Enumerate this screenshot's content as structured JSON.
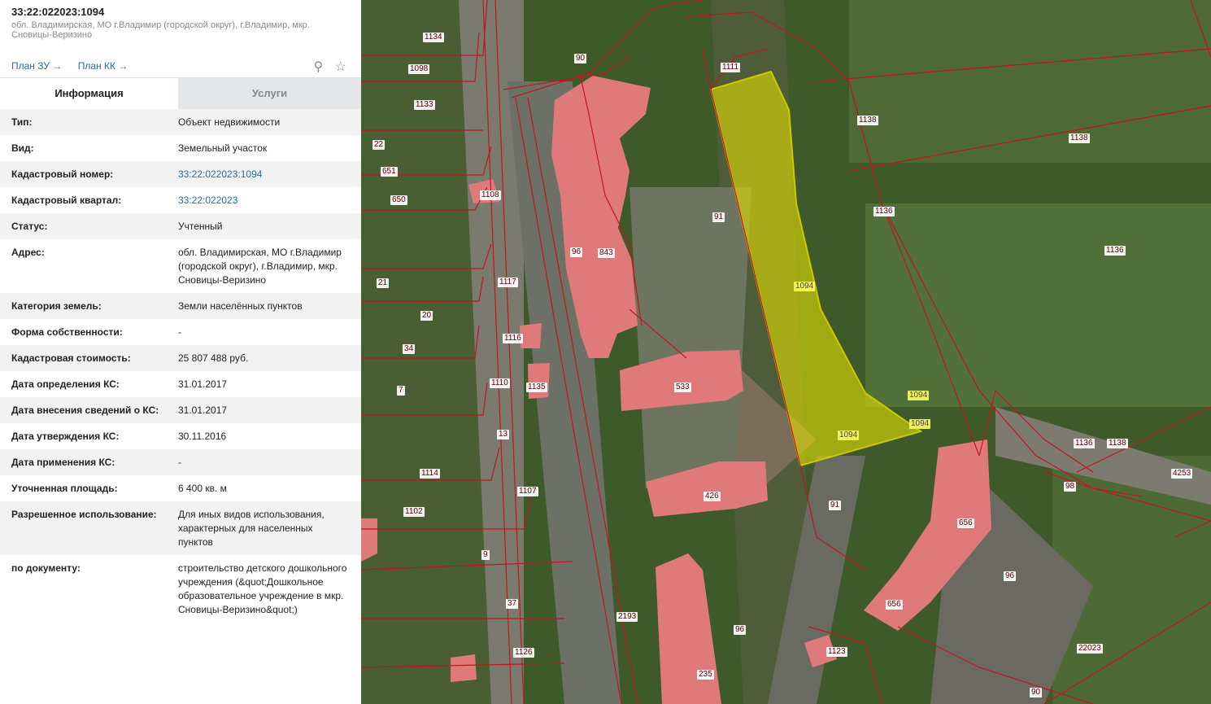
{
  "header": {
    "title": "33:22:022023:1094",
    "address": "обл. Владимирская, МО г.Владимир (городской округ), г.Владимир, мкр. Сновицы-Веризино",
    "links": [
      "План ЗУ →",
      "План КК →"
    ]
  },
  "tabs": {
    "info": "Информация",
    "services": "Услуги"
  },
  "rows": [
    {
      "k": "Тип:",
      "v": "Объект недвижимости"
    },
    {
      "k": "Вид:",
      "v": "Земельный участок"
    },
    {
      "k": "Кадастровый номер:",
      "v": "33:22:022023:1094"
    },
    {
      "k": "Кадастровый квартал:",
      "v": "33:22:022023"
    },
    {
      "k": "Статус:",
      "v": "Учтенный"
    },
    {
      "k": "Адрес:",
      "v": "обл. Владимирская, МО г.Владимир (городской округ), г.Владимир, мкр. Сновицы-Веризино"
    },
    {
      "k": "Категория земель:",
      "v": "Земли населённых пунктов"
    },
    {
      "k": "Форма собственности:",
      "v": "-"
    },
    {
      "k": "Кадастровая стоимость:",
      "v": "25 807 488 руб."
    },
    {
      "k": "Дата определения КС:",
      "v": "31.01.2017"
    },
    {
      "k": "Дата внесения сведений о КС:",
      "v": "31.01.2017"
    },
    {
      "k": "Дата утверждения КС:",
      "v": "30.11.2016"
    },
    {
      "k": "Дата применения КС:",
      "v": "-"
    },
    {
      "k": "Уточненная площадь:",
      "v": "6 400 кв. м"
    },
    {
      "k": "Разрешенное использование:",
      "v": "Для иных видов использования, характерных для населенных пунктов"
    },
    {
      "k": "по документу:",
      "v": "строительство детского дошкольного учреждения (&quot;Дошкольное образовательное учреждение в мкр. Сновицы-Веризино&quot;)"
    }
  ],
  "map_labels": [
    "1134",
    "90",
    "1111",
    "1098",
    "1133",
    "1138",
    "22",
    "651",
    "1108",
    "650",
    "91",
    "1136",
    "96",
    "843",
    "21",
    "1117",
    "20",
    "1116",
    "34",
    "533",
    "1110",
    "1135",
    "7",
    "13",
    "1114",
    "1107",
    "426",
    "1102",
    "9",
    "37",
    "1126",
    "2193",
    "235",
    "656",
    "1123",
    "1094",
    "4253",
    "98",
    "22023"
  ]
}
